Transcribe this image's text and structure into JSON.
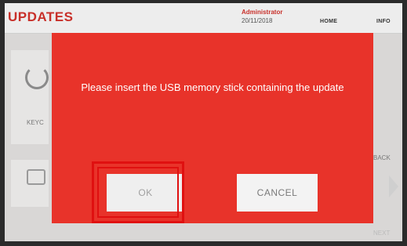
{
  "header": {
    "title": "UPDATES",
    "user": "Administrator",
    "date": "20/11/2018",
    "nav": [
      "HOME",
      "INFO"
    ]
  },
  "background": {
    "left_label": "KEYC",
    "right_back": "BACK",
    "right_next": "NEXT"
  },
  "dialog": {
    "message": "Please insert the USB memory stick containing the update",
    "ok_label": "OK",
    "cancel_label": "CANCEL"
  },
  "colors": {
    "dialog_bg": "#e8332a",
    "brand_red": "#c8302a",
    "highlight": "#e01010"
  }
}
